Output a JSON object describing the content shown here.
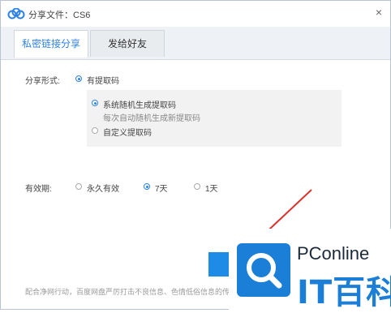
{
  "window": {
    "title": "分享文件：CS6",
    "close_glyph": "×"
  },
  "tabs": [
    {
      "label": "私密链接分享",
      "active": true
    },
    {
      "label": "发给好友",
      "active": false
    }
  ],
  "share_form": {
    "label": "分享形式:",
    "option": "有提取码",
    "sub_options": [
      {
        "label": "系统随机生成提取码",
        "desc": "每次自动随机生成新提取码",
        "selected": true
      },
      {
        "label": "自定义提取码",
        "selected": false
      }
    ]
  },
  "validity": {
    "label": "有效期:",
    "options": [
      {
        "label": "永久有效",
        "selected": false
      },
      {
        "label": "7天",
        "selected": true
      },
      {
        "label": "1天",
        "selected": false
      }
    ]
  },
  "notice": "配合净网行动，百度网盘严厉打击不良信息、色情低俗信息的传",
  "watermark": {
    "brand": "PConline",
    "name": "IT百科"
  },
  "colors": {
    "accent": "#2d82e6",
    "arrow": "#d9312b",
    "watermark_blue": "#1b7fd8"
  }
}
